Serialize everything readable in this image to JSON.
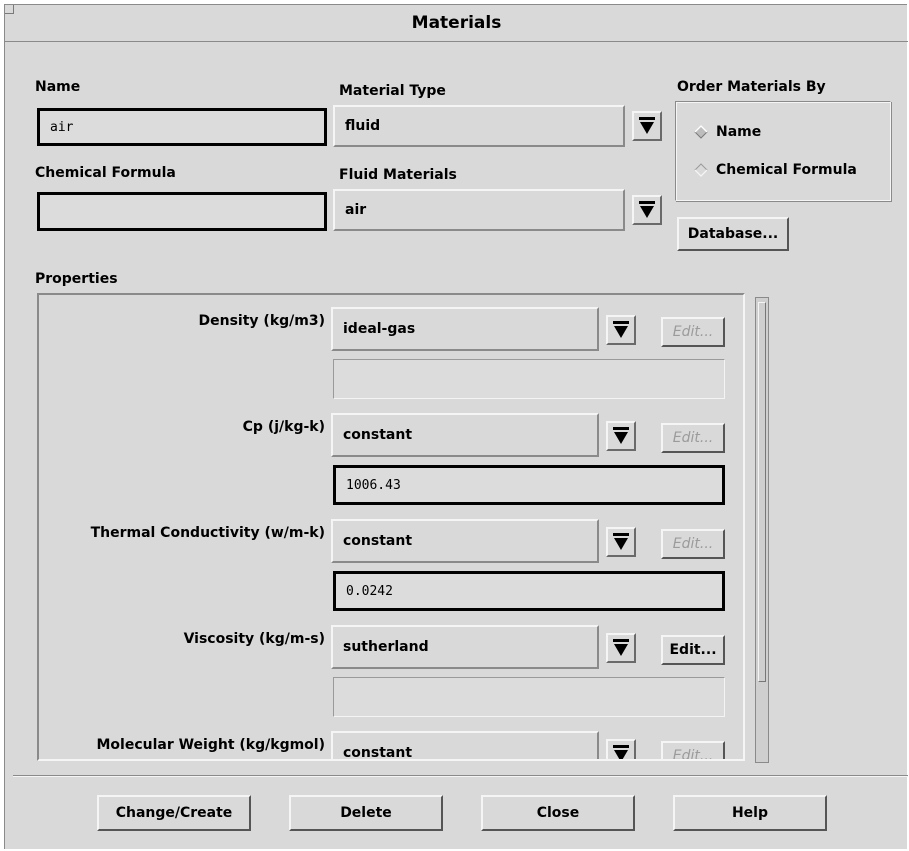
{
  "window": {
    "title": "Materials"
  },
  "name": {
    "label": "Name",
    "value": "air"
  },
  "chemical_formula": {
    "label": "Chemical Formula",
    "value": ""
  },
  "material_type": {
    "label": "Material Type",
    "value": "fluid"
  },
  "fluid_materials": {
    "label": "Fluid Materials",
    "value": "air"
  },
  "order_by": {
    "label": "Order Materials By",
    "options": [
      "Name",
      "Chemical Formula"
    ],
    "selected": "Name"
  },
  "database_button": "Database...",
  "properties": {
    "label": "Properties",
    "rows": [
      {
        "label": "Density (kg/m3)",
        "method": "ideal-gas",
        "edit": "Edit...",
        "edit_enabled": false,
        "value": ""
      },
      {
        "label": "Cp (j/kg-k)",
        "method": "constant",
        "edit": "Edit...",
        "edit_enabled": false,
        "value": "1006.43"
      },
      {
        "label": "Thermal Conductivity (w/m-k)",
        "method": "constant",
        "edit": "Edit...",
        "edit_enabled": false,
        "value": "0.0242"
      },
      {
        "label": "Viscosity (kg/m-s)",
        "method": "sutherland",
        "edit": "Edit...",
        "edit_enabled": true,
        "value": ""
      },
      {
        "label": "Molecular Weight (kg/kgmol)",
        "method": "constant",
        "edit": "Edit...",
        "edit_enabled": false,
        "value": ""
      }
    ]
  },
  "buttons": {
    "change_create": "Change/Create",
    "delete": "Delete",
    "close": "Close",
    "help": "Help"
  }
}
